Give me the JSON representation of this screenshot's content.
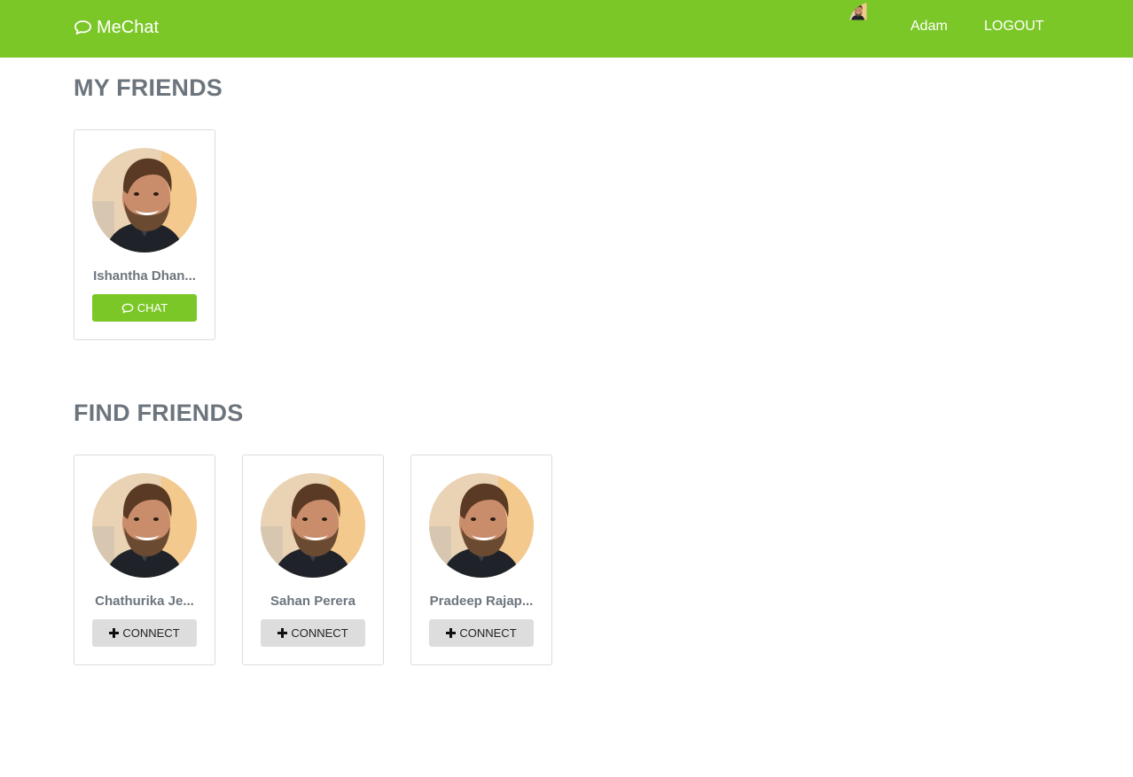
{
  "navbar": {
    "brand": "MeChat",
    "brand_icon": "chat-bubble-icon",
    "user_name": "Adam",
    "logout_label": "LOGOUT",
    "color": "#7cc728"
  },
  "my_friends": {
    "title": "MY FRIENDS",
    "cards": [
      {
        "name": "Ishantha Dhan...",
        "button_label": "CHAT",
        "button_icon": "chat-bubble-icon"
      }
    ]
  },
  "find_friends": {
    "title": "FIND FRIENDS",
    "cards": [
      {
        "name": "Chathurika Je...",
        "button_label": "CONNECT",
        "button_icon": "plus-icon"
      },
      {
        "name": "Sahan Perera",
        "button_label": "CONNECT",
        "button_icon": "plus-icon"
      },
      {
        "name": "Pradeep Rajap...",
        "button_label": "CONNECT",
        "button_icon": "plus-icon"
      }
    ]
  }
}
